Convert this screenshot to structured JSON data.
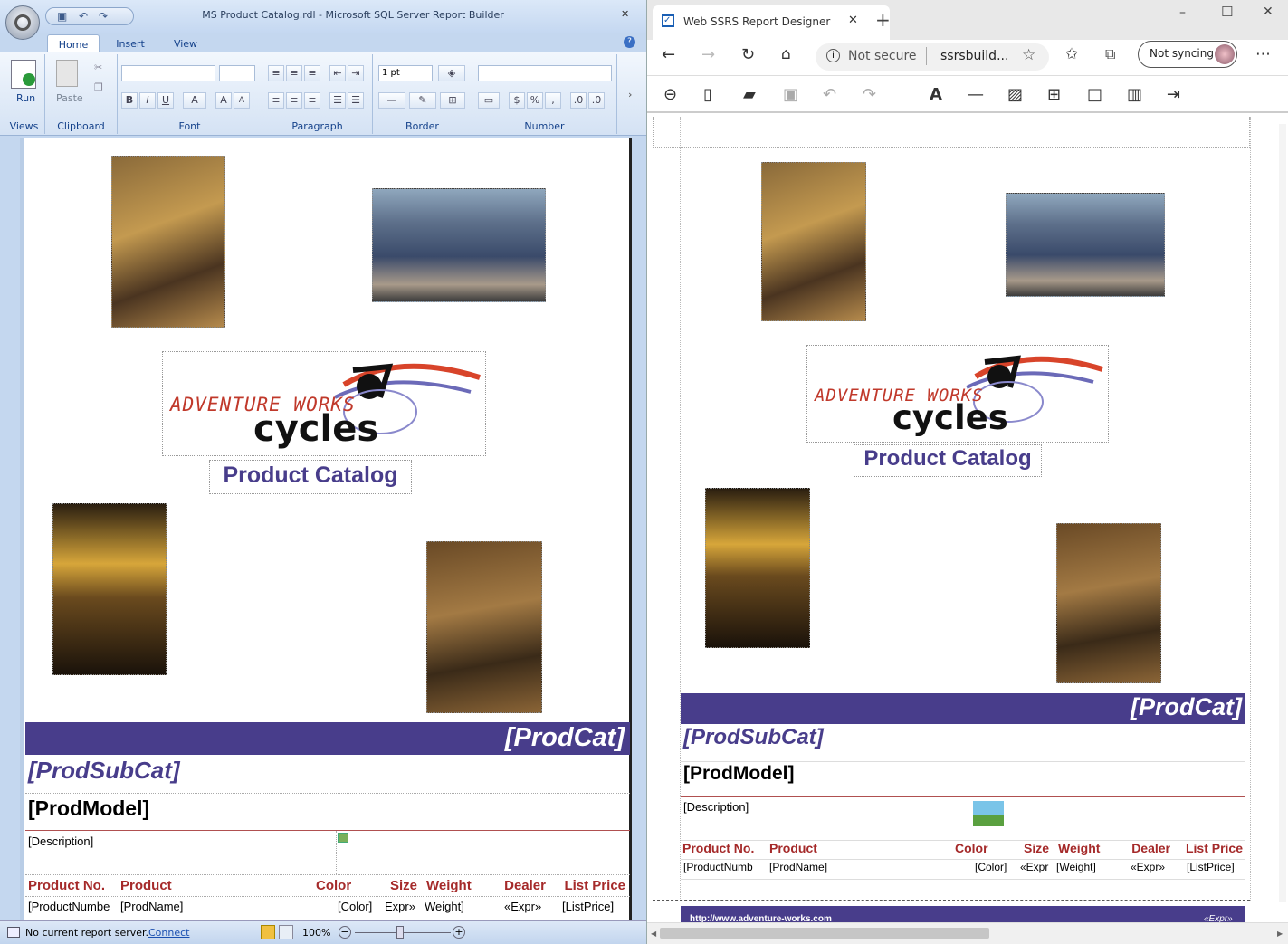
{
  "left_window": {
    "title": "MS Product Catalog.rdl - Microsoft SQL Server Report Builder",
    "tabs": [
      "Home",
      "Insert",
      "View"
    ],
    "ribbon": {
      "run_label": "Run",
      "paste_label": "Paste",
      "border_width": "1 pt",
      "groups": [
        "Views",
        "Clipboard",
        "Font",
        "Paragraph",
        "Border",
        "Number"
      ]
    },
    "status": {
      "text": "No current report server.",
      "connect": "Connect",
      "zoom": "100%"
    }
  },
  "report": {
    "logo_line1": "ADVENTURE WORKS",
    "logo_line2": "cycles",
    "title": "Product Catalog",
    "prodcat": "[ProdCat]",
    "prodsubcat": "[ProdSubCat]",
    "prodmodel": "[ProdModel]",
    "description": "[Description]",
    "headers": [
      "Product No.",
      "Product",
      "Color",
      "Size",
      "Weight",
      "Dealer",
      "List Price"
    ],
    "left_row": [
      "[ProductNumbe",
      "[ProdName]",
      "[Color]",
      "Expr»",
      "Weight]",
      "«Expr»",
      "[ListPrice]"
    ],
    "right_row": [
      "[ProductNumb",
      "[ProdName]",
      "[Color]",
      "«Expr",
      "[Weight]",
      "«Expr»",
      "[ListPrice]"
    ],
    "footer_url": "http://www.adventure-works.com",
    "footer_expr": "«Expr»"
  },
  "right_window": {
    "tab_title": "Web SSRS Report Designer",
    "not_secure": "Not secure",
    "url": "ssrsbuild...",
    "sync": "Not syncing"
  },
  "colors": {
    "accent": "#483d8b",
    "header": "#a52a2a"
  }
}
